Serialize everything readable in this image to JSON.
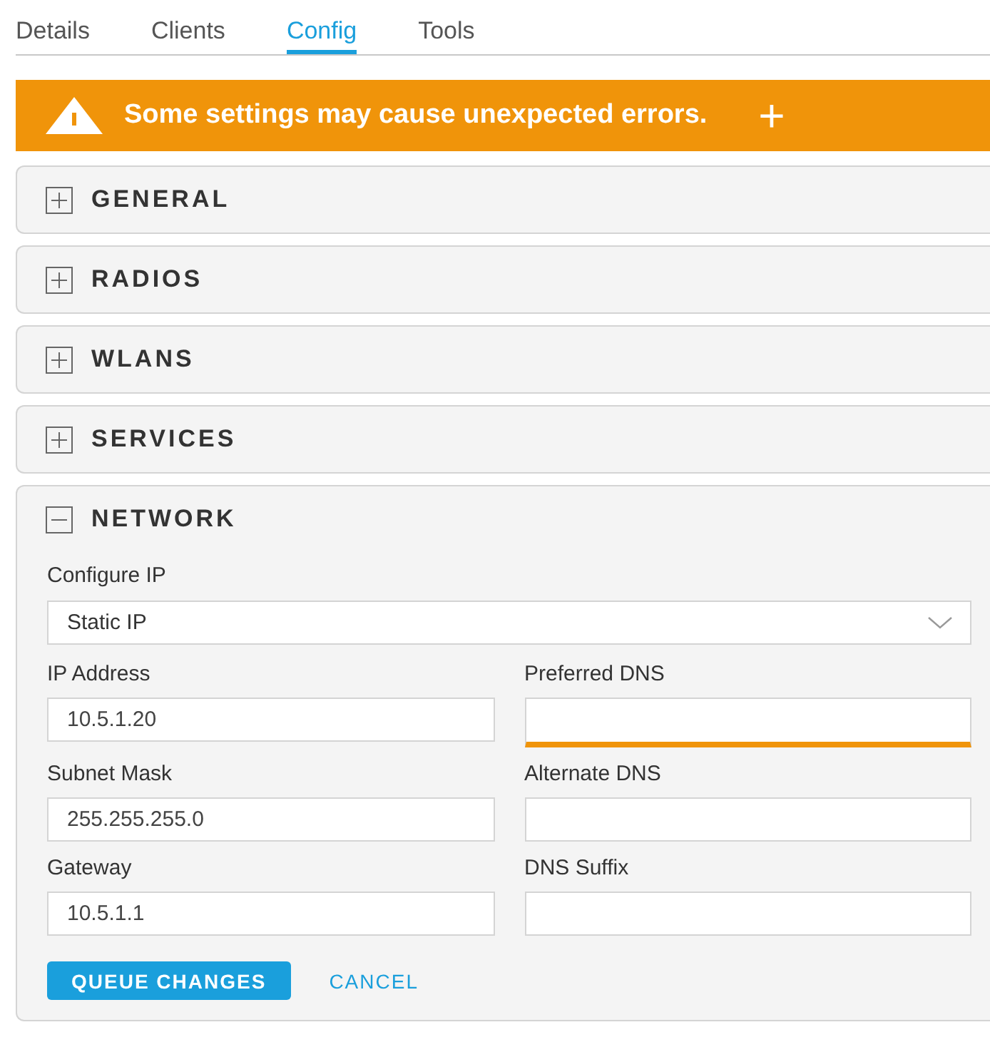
{
  "tabs": [
    {
      "label": "Details",
      "selected": false
    },
    {
      "label": "Clients",
      "selected": false
    },
    {
      "label": "Config",
      "selected": true
    },
    {
      "label": "Tools",
      "selected": false
    }
  ],
  "banner": {
    "message": "Some settings may cause unexpected errors.",
    "action": "+"
  },
  "sections": [
    {
      "title": "GENERAL",
      "expanded": false
    },
    {
      "title": "RADIOS",
      "expanded": false
    },
    {
      "title": "WLANS",
      "expanded": false
    },
    {
      "title": "SERVICES",
      "expanded": false
    },
    {
      "title": "NETWORK",
      "expanded": true
    }
  ],
  "network_form": {
    "configure_ip": {
      "label": "Configure IP",
      "value": "Static IP"
    },
    "fields": [
      {
        "label": "IP Address",
        "value": "10.5.1.20",
        "focused": false
      },
      {
        "label": "Preferred DNS",
        "focused": true
      },
      {
        "label": "Subnet Mask",
        "value": "255.255.255.0",
        "focused": false
      },
      {
        "label": "Alternate DNS",
        "focused": false
      },
      {
        "label": "Gateway",
        "value": "10.5.1.1",
        "focused": false
      },
      {
        "label": "DNS Suffix",
        "focused": false
      }
    ],
    "buttons": [
      {
        "label": "QUEUE CHANGES",
        "kind": "primary"
      },
      {
        "label": "CANCEL",
        "kind": "link"
      }
    ]
  }
}
